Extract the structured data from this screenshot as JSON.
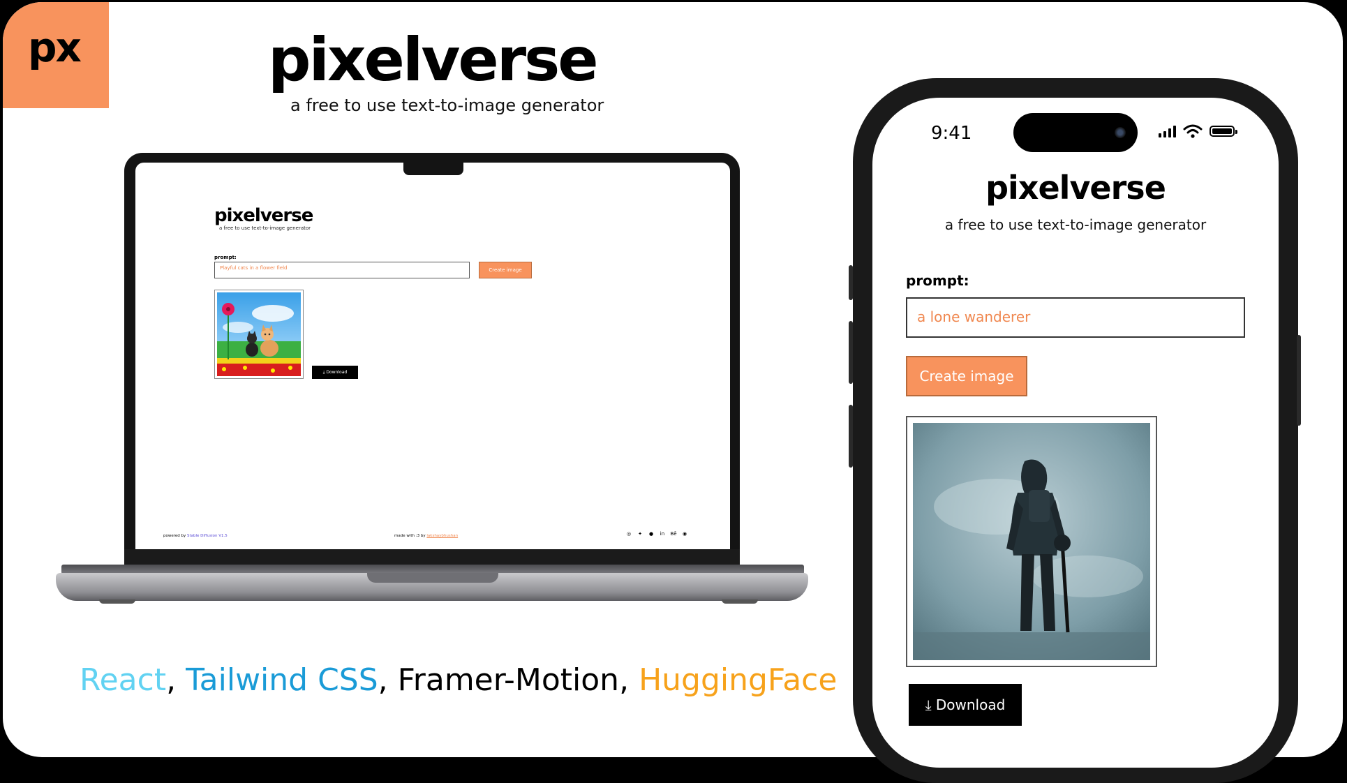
{
  "brand": {
    "logo_text": "px",
    "title": "pixelverse",
    "subtitle": "a free to use text-to-image generator",
    "accent_color": "#f8935d"
  },
  "laptop_app": {
    "title": "pixelverse",
    "subtitle": "a free to use text-to-image generator",
    "prompt_label": "prompt:",
    "prompt_value": "Playful cats in a flower field",
    "create_button": "Create image",
    "download_button": "Download",
    "footer": {
      "powered_prefix": "powered by",
      "powered_link": "Stable Diffusion V1.5",
      "made_prefix": "made with :3 by",
      "made_link": "lakshaybhushan",
      "social_icons": [
        "instagram-icon",
        "twitter-icon",
        "github-icon",
        "linkedin-icon",
        "behance-icon",
        "spotify-icon"
      ],
      "behance_text": "Bē",
      "linkedin_text": "in"
    }
  },
  "phone_app": {
    "time": "9:41",
    "title": "pixelverse",
    "subtitle": "a free to use text-to-image generator",
    "prompt_label": "prompt:",
    "prompt_value": "a lone wanderer",
    "create_button": "Create image",
    "download_button": "Download"
  },
  "tech_stack": {
    "react": "React",
    "sep1": ", ",
    "tailwind": "Tailwind CSS",
    "sep2": ", ",
    "framer": "Framer-Motion",
    "sep3": ", ",
    "hf": "HuggingFace",
    "colors": {
      "react": "#61d2f2",
      "tailwind": "#1a9bd7",
      "framer": "#000000",
      "hf": "#f7a21b"
    }
  }
}
